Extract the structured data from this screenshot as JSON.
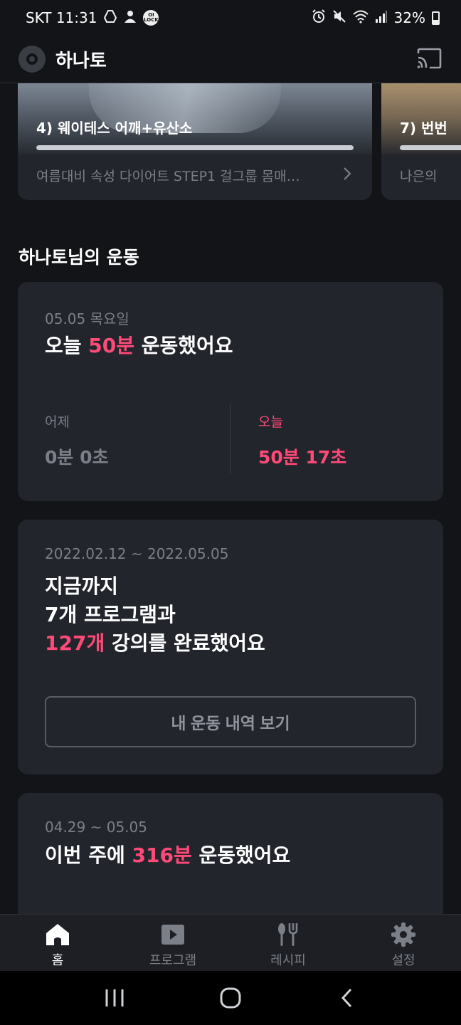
{
  "status_bar": {
    "carrier_time": "SKT 11:31",
    "badge_text": "OI LOCK",
    "battery": "32%",
    "battery_level": 0.32,
    "icons": [
      "drive-icon",
      "person-icon",
      "ollock-icon",
      "alarm-icon",
      "mute-icon",
      "wifi-icon",
      "signal-icon",
      "battery-icon"
    ]
  },
  "header": {
    "app_name": "하나토",
    "icons": [
      "app-logo-icon",
      "cast-icon"
    ]
  },
  "programs": [
    {
      "title": "4) 웨이테스 어깨+유산소",
      "subtitle": "여름대비 속성 다이어트 STEP1 걸그룹 몸매…",
      "progress": 1.0
    },
    {
      "title": "7) 번번",
      "subtitle": "나은의",
      "progress": 1.0
    }
  ],
  "section": {
    "title": "하나토님의 운동"
  },
  "today_card": {
    "date": "05.05 목요일",
    "headline_pre": "오늘 ",
    "headline_accent": "50분",
    "headline_post": " 운동했어요",
    "yesterday_label": "어제",
    "yesterday_value": "0분 0초",
    "today_label": "오늘",
    "today_value": "50분 17초"
  },
  "total_card": {
    "date_range": "2022.02.12 ~ 2022.05.05",
    "line1": "지금까지",
    "line2": "7개 프로그램과",
    "line3_accent": "127개",
    "line3_post": " 강의를 완료했어요",
    "button_label": "내 운동 내역 보기"
  },
  "week_card": {
    "date_range": "04.29 ~ 05.05",
    "headline_pre": "이번 주에 ",
    "headline_accent": "316분",
    "headline_post": " 운동했어요"
  },
  "bottom_nav": {
    "items": [
      {
        "label": "홈",
        "icon": "home-icon",
        "active": true
      },
      {
        "label": "프로그램",
        "icon": "play-icon",
        "active": false
      },
      {
        "label": "레시피",
        "icon": "utensils-icon",
        "active": false
      },
      {
        "label": "설정",
        "icon": "gear-icon",
        "active": false
      }
    ]
  },
  "system_nav": {
    "icons": [
      "recents-icon",
      "home-circle-icon",
      "back-icon"
    ]
  },
  "colors": {
    "background": "#121417",
    "card": "#23252d",
    "accent": "#ff4a78",
    "muted_text": "#7b7f87"
  }
}
